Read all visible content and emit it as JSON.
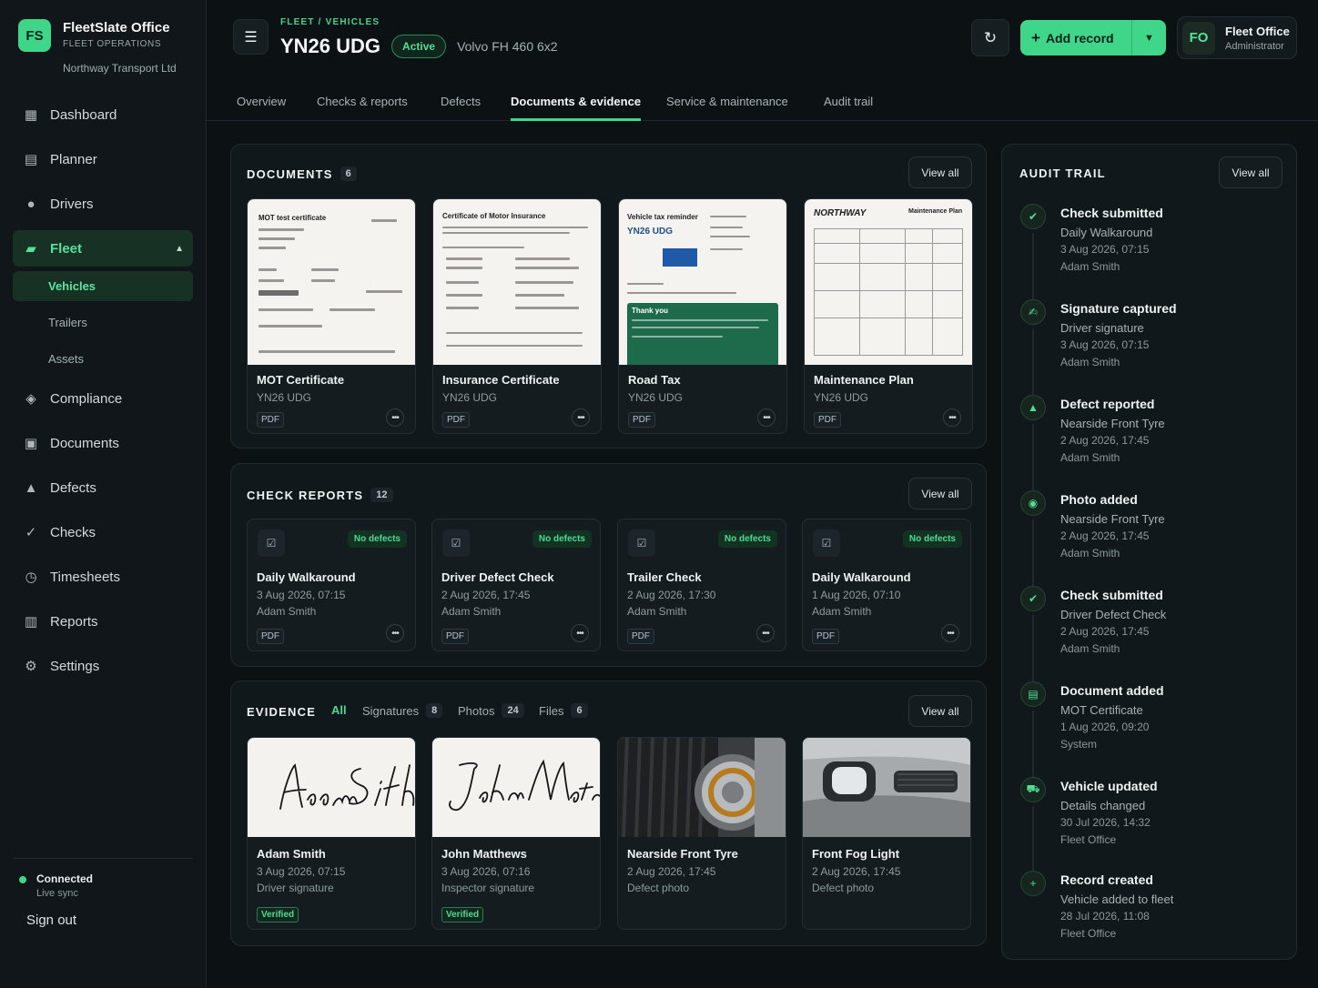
{
  "brand": {
    "logo": "FS",
    "name": "FleetSlate Office",
    "sub": "FLEET OPERATIONS",
    "org": "Northway Transport Ltd"
  },
  "nav": [
    {
      "label": "Dashboard",
      "icon": "grid-icon",
      "glyph": "▦"
    },
    {
      "label": "Planner",
      "icon": "planner-icon",
      "glyph": "▤"
    },
    {
      "label": "Drivers",
      "icon": "person-icon",
      "glyph": "👤"
    },
    {
      "label": "Fleet",
      "icon": "truck-icon",
      "glyph": "▰"
    },
    {
      "label": "Compliance",
      "icon": "diamond-icon",
      "glyph": "◈"
    },
    {
      "label": "Documents",
      "icon": "document-icon",
      "glyph": "▣"
    },
    {
      "label": "Defects",
      "icon": "warning-icon",
      "glyph": "▲"
    },
    {
      "label": "Checks",
      "icon": "check-icon",
      "glyph": "✓"
    },
    {
      "label": "Timesheets",
      "icon": "clock-icon",
      "glyph": "◷"
    },
    {
      "label": "Reports",
      "icon": "bar-chart-icon",
      "glyph": "▥"
    },
    {
      "label": "Settings",
      "icon": "gear-icon",
      "glyph": "⚙"
    }
  ],
  "subnav": [
    "Vehicles",
    "Trailers",
    "Assets"
  ],
  "footer": {
    "status": "Connected",
    "status_sub": "Live sync",
    "signout": "Sign out"
  },
  "header": {
    "breadcrumb": "FLEET / VEHICLES",
    "title": "YN26 UDG",
    "status": "Active",
    "model": "Volvo FH 460 6x2",
    "add_label": "Add record",
    "user_initials": "FO",
    "user_name": "Fleet Office",
    "user_role": "Administrator"
  },
  "tabs": [
    "Overview",
    "Checks & reports",
    "Defects",
    "Documents & evidence",
    "Service & maintenance",
    "Audit trail"
  ],
  "documents": {
    "title": "DOCUMENTS",
    "count": "6",
    "view_all": "View all",
    "items": [
      {
        "title": "MOT Certificate",
        "sub": "YN26 UDG",
        "tag": "PDF",
        "thumb_head": "MOT test certificate"
      },
      {
        "title": "Insurance Certificate",
        "sub": "YN26 UDG",
        "tag": "PDF",
        "thumb_head": "Certificate of Motor Insurance"
      },
      {
        "title": "Road Tax",
        "sub": "YN26 UDG",
        "tag": "PDF",
        "thumb_head": "Vehicle tax reminder",
        "thumb_reg": "YN26 UDG",
        "thumb_note": "Thank you"
      },
      {
        "title": "Maintenance Plan",
        "sub": "YN26 UDG",
        "tag": "PDF",
        "thumb_head": "NORTHWAY",
        "thumb_head2": "Maintenance Plan"
      }
    ]
  },
  "checks": {
    "title": "CHECK REPORTS",
    "count": "12",
    "view_all": "View all",
    "items": [
      {
        "badge": "No defects",
        "title": "Daily Walkaround",
        "time": "3 Aug 2026, 07:15",
        "user": "Adam Smith",
        "tag": "PDF"
      },
      {
        "badge": "No defects",
        "title": "Driver Defect Check",
        "time": "2 Aug 2026, 17:45",
        "user": "Adam Smith",
        "tag": "PDF"
      },
      {
        "badge": "No defects",
        "title": "Trailer Check",
        "time": "2 Aug 2026, 17:30",
        "user": "Adam Smith",
        "tag": "PDF"
      },
      {
        "badge": "No defects",
        "title": "Daily Walkaround",
        "time": "1 Aug 2026, 07:10",
        "user": "Adam Smith",
        "tag": "PDF"
      }
    ]
  },
  "evidence": {
    "title": "EVIDENCE",
    "view_all": "View all",
    "filters": [
      {
        "label": "All",
        "count": ""
      },
      {
        "label": "Signatures",
        "count": "8"
      },
      {
        "label": "Photos",
        "count": "24"
      },
      {
        "label": "Files",
        "count": "6"
      }
    ],
    "items": [
      {
        "title": "Adam Smith",
        "time": "3 Aug 2026, 07:15",
        "sub": "Driver signature",
        "badge": "Verified",
        "signature": "Adam Smith"
      },
      {
        "title": "John Matthews",
        "time": "3 Aug 2026, 07:16",
        "sub": "Inspector signature",
        "badge": "Verified",
        "signature": "John Matthews"
      },
      {
        "title": "Nearside Front Tyre",
        "time": "2 Aug 2026, 17:45",
        "sub": "Defect photo",
        "badge": ""
      },
      {
        "title": "Front Fog Light",
        "time": "2 Aug 2026, 17:45",
        "sub": "Defect photo",
        "badge": ""
      }
    ]
  },
  "audit": {
    "title": "AUDIT TRAIL",
    "view_all": "View all",
    "items": [
      {
        "icon": "check-square-icon",
        "glyph": "✔",
        "title": "Check submitted",
        "detail": "Daily Walkaround",
        "time": "3 Aug 2026, 07:15",
        "user": "Adam Smith"
      },
      {
        "icon": "signature-icon",
        "glyph": "✍",
        "title": "Signature captured",
        "detail": "Driver signature",
        "time": "3 Aug 2026, 07:15",
        "user": "Adam Smith"
      },
      {
        "icon": "warning-icon",
        "glyph": "▲",
        "title": "Defect reported",
        "detail": "Nearside Front Tyre",
        "time": "2 Aug 2026, 17:45",
        "user": "Adam Smith"
      },
      {
        "icon": "camera-icon",
        "glyph": "◉",
        "title": "Photo added",
        "detail": "Nearside Front Tyre",
        "time": "2 Aug 2026, 17:45",
        "user": "Adam Smith"
      },
      {
        "icon": "check-square-icon",
        "glyph": "✔",
        "title": "Check submitted",
        "detail": "Driver Defect Check",
        "time": "2 Aug 2026, 17:45",
        "user": "Adam Smith"
      },
      {
        "icon": "document-icon",
        "glyph": "▤",
        "title": "Document added",
        "detail": "MOT Certificate",
        "time": "1 Aug 2026, 09:20",
        "user": "System"
      },
      {
        "icon": "car-icon",
        "glyph": "⛟",
        "title": "Vehicle updated",
        "detail": "Details changed",
        "time": "30 Jul 2026, 14:32",
        "user": "Fleet Office"
      },
      {
        "icon": "plus-icon",
        "glyph": "+",
        "title": "Record created",
        "detail": "Vehicle added to fleet",
        "time": "28 Jul 2026, 11:08",
        "user": "Fleet Office"
      }
    ]
  }
}
